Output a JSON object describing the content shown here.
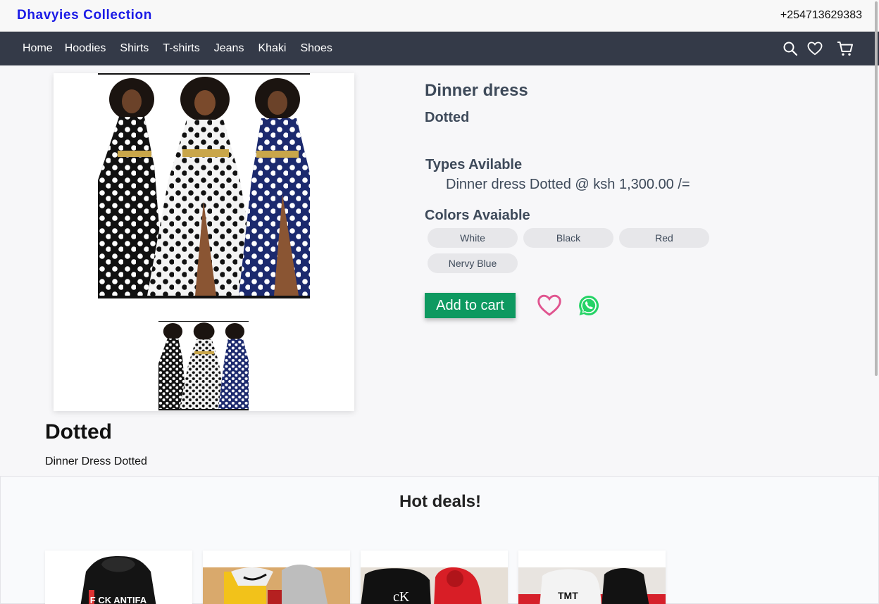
{
  "header": {
    "brand": "Dhavyies Collection",
    "phone": "+254713629383"
  },
  "nav": {
    "links": [
      "Home",
      "Hoodies",
      "Shirts",
      "T-shirts",
      "Jeans",
      "Khaki",
      "Shoes"
    ],
    "icons": [
      "search-icon",
      "heart-icon",
      "cart-icon"
    ]
  },
  "product": {
    "title": "Dinner dress",
    "subtitle": "Dotted",
    "types_heading": "Types Avilable",
    "types_value": "Dinner dress Dotted @ ksh 1,300.00 /=",
    "colors_heading": "Colors Avaiable",
    "colors": [
      "White",
      "Black",
      "Red",
      "Nervy Blue"
    ],
    "add_to_cart": "Add to cart"
  },
  "description": {
    "title": "Dotted",
    "text": "Dinner Dress Dotted"
  },
  "hot_deals": {
    "title": "Hot deals!",
    "items": [
      "black-hoodie-printed",
      "yellow-and-grey-sweatsuit",
      "black-and-red-hoodies",
      "white-red-black-hoodies"
    ],
    "hoodie_print": "F CK ANTIFA",
    "brand_print_1": "cK",
    "brand_print_2": "TMT"
  },
  "colors": {
    "brand": "#1a1ae6",
    "navbar": "#343a48",
    "add_to_cart": "#0d9960",
    "heart": "#e0548f",
    "whatsapp": "#25d366"
  }
}
